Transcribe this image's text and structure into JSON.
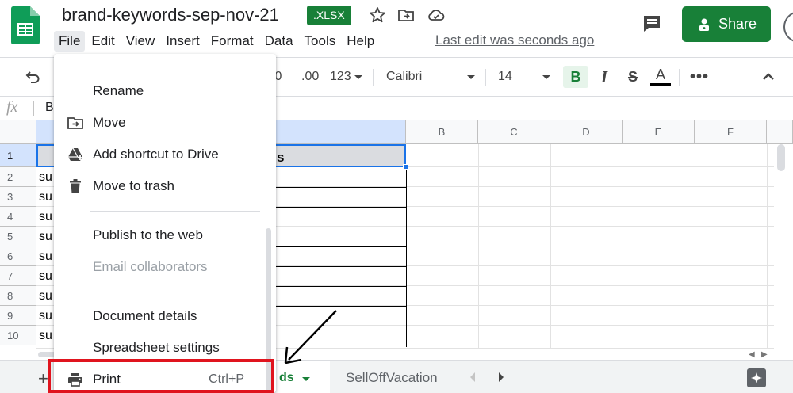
{
  "title_bar": {
    "doc_title": "brand-keywords-sep-nov-21",
    "format_badge": ".XLSX",
    "last_edit": "Last edit was seconds ago",
    "share_label": "Share"
  },
  "menubar": {
    "items": [
      "File",
      "Edit",
      "View",
      "Insert",
      "Format",
      "Data",
      "Tools",
      "Help"
    ]
  },
  "toolbar": {
    "decrease_decimal": ".0",
    "increase_decimal": ".00",
    "number_format": "123",
    "font_family": "Calibri",
    "font_size": "14",
    "bold": "B",
    "italic": "I",
    "strike": "S",
    "text_color": "A",
    "more": "•••"
  },
  "formula_bar": {
    "fx": "fx",
    "value": "B"
  },
  "grid": {
    "column_headers": [
      "B",
      "C",
      "D",
      "E",
      "F"
    ],
    "row_headers": [
      "1",
      "2",
      "3",
      "4",
      "5",
      "6",
      "7",
      "8",
      "9",
      "10"
    ],
    "a1_visible_text": "s",
    "col_a_visible_values": [
      "su",
      "su",
      "su",
      "su",
      "su",
      "su",
      "su",
      "su",
      "su"
    ]
  },
  "file_menu": {
    "items": [
      {
        "label": "Rename",
        "icon": "none"
      },
      {
        "label": "Move",
        "icon": "move-folder-icon"
      },
      {
        "label": "Add shortcut to Drive",
        "icon": "drive-shortcut-icon"
      },
      {
        "label": "Move to trash",
        "icon": "trash-icon"
      },
      {
        "label": "Publish to the web",
        "icon": "none"
      },
      {
        "label": "Email collaborators",
        "icon": "none",
        "disabled": true
      },
      {
        "label": "Document details",
        "icon": "none"
      },
      {
        "label": "Spreadsheet settings",
        "icon": "none"
      },
      {
        "label": "Print",
        "icon": "printer-icon",
        "shortcut": "Ctrl+P"
      }
    ]
  },
  "sheet_bar": {
    "add_label": "+",
    "active_tab_visible": "ds",
    "second_tab": "SellOffVacation"
  },
  "colors": {
    "brand_green": "#188038",
    "selection_blue": "#1a73e8",
    "highlight_red": "#e0141e"
  }
}
